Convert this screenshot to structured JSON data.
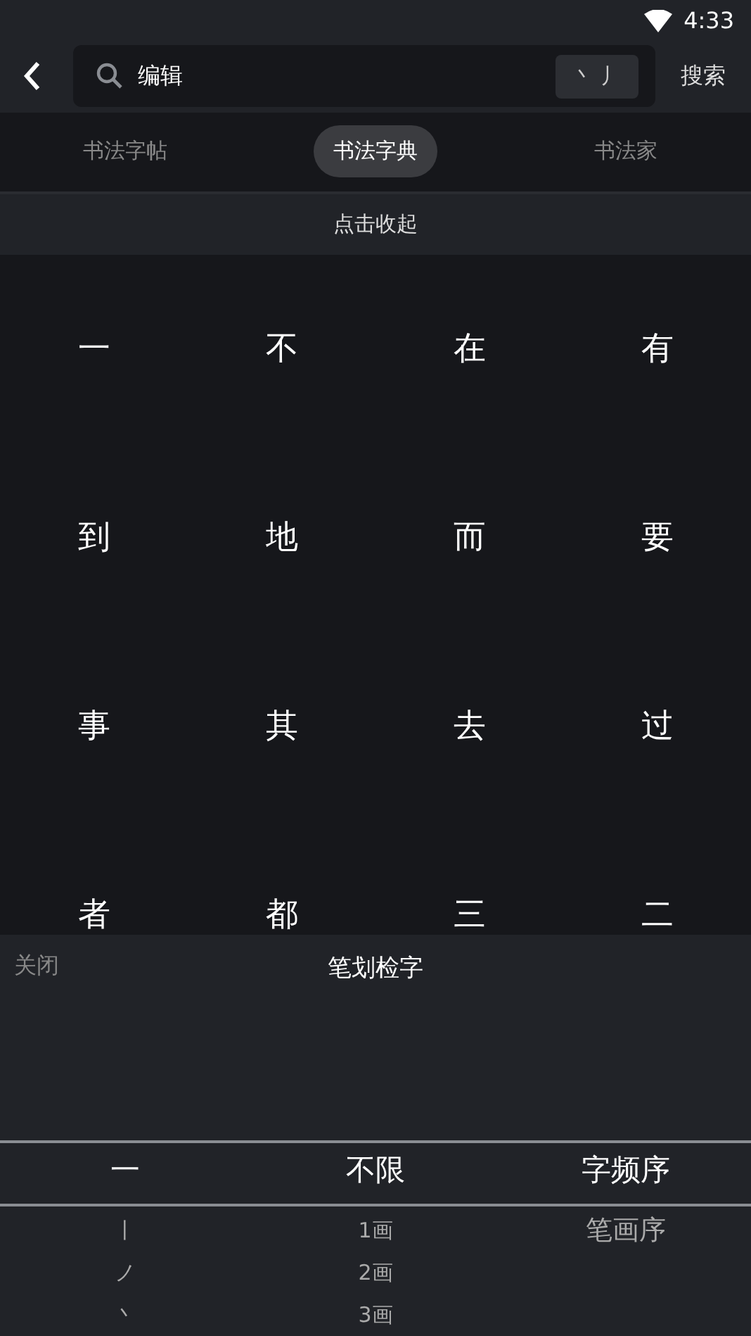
{
  "status_bar": {
    "time": "4:33"
  },
  "search": {
    "value": "编辑",
    "stroke_key": "丶 丿",
    "submit": "搜索"
  },
  "tabs": [
    {
      "label": "书法字帖",
      "selected": false
    },
    {
      "label": "书法字典",
      "selected": true
    },
    {
      "label": "书法家",
      "selected": false
    }
  ],
  "collapse": "点击收起",
  "characters": [
    "一",
    "不",
    "在",
    "有",
    "到",
    "地",
    "而",
    "要",
    "事",
    "其",
    "去",
    "过",
    "者",
    "都",
    "三",
    "二"
  ],
  "stroke_panel": {
    "close": "关闭",
    "title": "笔划检字",
    "pickers": [
      [
        {
          "label": "一",
          "selected": true
        },
        {
          "label": "丨",
          "selected": false
        },
        {
          "label": "ノ",
          "selected": false
        },
        {
          "label": "丶",
          "selected": false
        }
      ],
      [
        {
          "label": "不限",
          "selected": true
        },
        {
          "label": "1画",
          "selected": false
        },
        {
          "label": "2画",
          "selected": false
        },
        {
          "label": "3画",
          "selected": false
        }
      ],
      [
        {
          "label": "字频序",
          "selected": true
        },
        {
          "label": "笔画序",
          "selected": false
        }
      ]
    ]
  }
}
